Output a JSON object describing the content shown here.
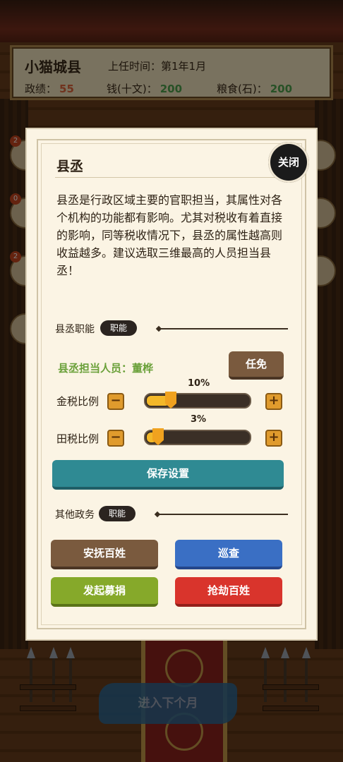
{
  "header": {
    "city": "小猫城县",
    "term_label": "上任时间：",
    "term_value": "第1年1月",
    "stats": [
      {
        "label": "政绩：",
        "value": "55",
        "color": "#e0643a"
      },
      {
        "label": "钱(十文)：",
        "value": "200",
        "color": "#4fa24c"
      },
      {
        "label": "粮食(石)：",
        "value": "200",
        "color": "#4fa24c"
      }
    ]
  },
  "side_badges": [
    "2",
    "0",
    "2"
  ],
  "modal": {
    "title": "县丞",
    "close_label": "关闭",
    "description": "县丞是行政区域主要的官职担当，其属性对各个机构的功能都有影响。尤其对税收有着直接的影响，同等税收情况下，县丞的属性越高则收益越多。建议选取三维最高的人员担当县丞！",
    "section1": {
      "label": "县丞职能",
      "tag": "职能"
    },
    "assignee": "县丞担当人员：董桦",
    "dismiss_label": "任免",
    "gold_tax": {
      "label": "金税比例",
      "percent_text": "10%",
      "value": 0.1,
      "minus": "−",
      "plus": "+"
    },
    "field_tax": {
      "label": "田税比例",
      "percent_text": "3%",
      "value": 0.03,
      "minus": "−",
      "plus": "+"
    },
    "save_label": "保存设置",
    "section2": {
      "label": "其他政务",
      "tag": "职能"
    },
    "actions": [
      {
        "label": "安抚百姓",
        "color": "#7a5a3e"
      },
      {
        "label": "巡查",
        "color": "#3a6fc4"
      },
      {
        "label": "发起募捐",
        "color": "#86a92a"
      },
      {
        "label": "抢劫百姓",
        "color": "#d9342c"
      }
    ]
  },
  "next_month_label": "进入下个月"
}
